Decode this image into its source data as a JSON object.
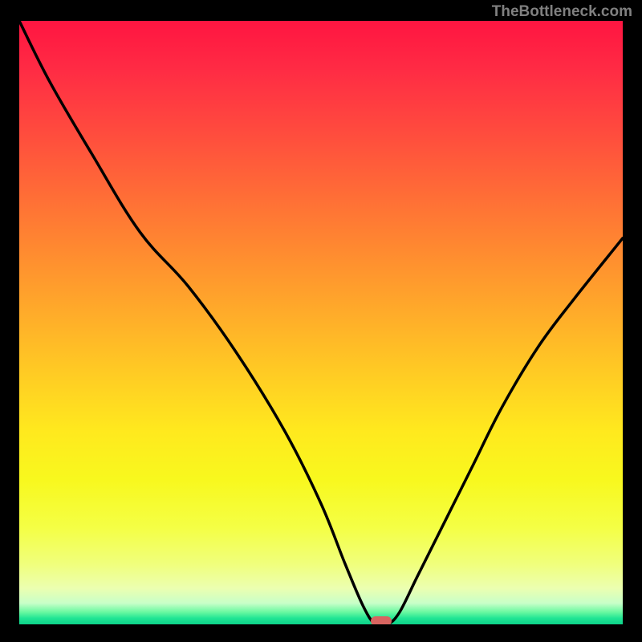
{
  "watermark": "TheBottleneck.com",
  "chart_data": {
    "type": "line",
    "title": "",
    "xlabel": "",
    "ylabel": "",
    "xlim": [
      0,
      100
    ],
    "ylim": [
      0,
      100
    ],
    "series": [
      {
        "name": "bottleneck-curve",
        "x": [
          0,
          5,
          12,
          20,
          28,
          36,
          44,
          50,
          54,
          57,
          59,
          61,
          63,
          66,
          70,
          75,
          80,
          86,
          92,
          100
        ],
        "y": [
          100,
          90,
          78,
          65,
          56,
          45,
          32,
          20,
          10,
          3,
          0,
          0,
          2,
          8,
          16,
          26,
          36,
          46,
          54,
          64
        ]
      }
    ],
    "marker": {
      "x": 60,
      "y": 0,
      "label": ""
    },
    "gradient_scale": {
      "top": "red (high bottleneck)",
      "middle": "yellow",
      "bottom": "green (no bottleneck)"
    }
  }
}
